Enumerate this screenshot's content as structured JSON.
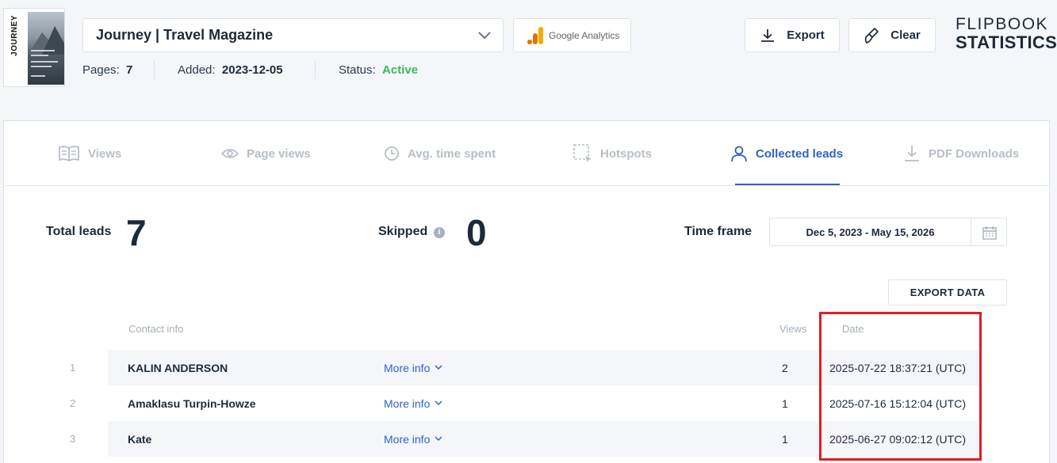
{
  "flipbook": {
    "cover_text": "JOURNEY",
    "title": "Journey | Travel Magazine",
    "pages_label": "Pages:",
    "pages_value": "7",
    "added_label": "Added:",
    "added_value": "2023-12-05",
    "status_label": "Status:",
    "status_value": "Active"
  },
  "header": {
    "ga_label": "Google Analytics",
    "export_label": "Export",
    "clear_label": "Clear",
    "brand_line1": "FLIPBOOK",
    "brand_line2": "STATISTICS"
  },
  "tabs": [
    {
      "label": "Views",
      "icon": "views-icon"
    },
    {
      "label": "Page views",
      "icon": "eye-icon"
    },
    {
      "label": "Avg. time spent",
      "icon": "clock-icon"
    },
    {
      "label": "Hotspots",
      "icon": "hotspot-icon"
    },
    {
      "label": "Collected leads",
      "icon": "user-icon",
      "active": true
    },
    {
      "label": "PDF Downloads",
      "icon": "download-icon"
    }
  ],
  "stats": {
    "total_label": "Total leads",
    "total_value": "7",
    "skipped_label": "Skipped",
    "skipped_value": "0",
    "timeframe_label": "Time frame",
    "timeframe_value": "Dec 5, 2023 - May 15, 2026"
  },
  "export_data_label": "EXPORT DATA",
  "table": {
    "headers": {
      "contact": "Contact info",
      "views": "Views",
      "date": "Date"
    },
    "more_info_label": "More info",
    "rows": [
      {
        "num": "1",
        "name": "KALIN ANDERSON",
        "views": "2",
        "date": "2025-07-22 18:37:21 (UTC)"
      },
      {
        "num": "2",
        "name": "Amaklasu Turpin-Howze",
        "views": "1",
        "date": "2025-07-16 15:12:04 (UTC)"
      },
      {
        "num": "3",
        "name": "Kate",
        "views": "1",
        "date": "2025-06-27 09:02:12 (UTC)"
      }
    ]
  },
  "colors": {
    "accent": "#2f62c7",
    "active": "#3cb95c",
    "highlight": "#e31b23"
  }
}
